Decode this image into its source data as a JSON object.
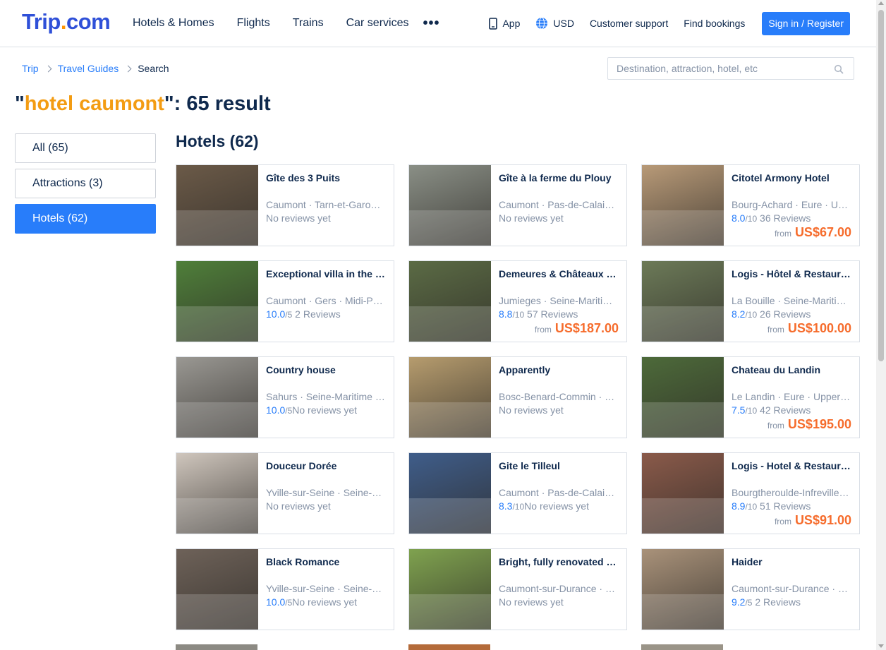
{
  "header": {
    "logo_main": "Trip",
    "logo_dot": ".",
    "logo_suffix": "com",
    "nav": [
      "Hotels & Homes",
      "Flights",
      "Trains",
      "Car services"
    ],
    "more": "•••",
    "app": "App",
    "currency": "USD",
    "support": "Customer support",
    "bookings": "Find bookings",
    "signin": "Sign in / Register"
  },
  "breadcrumb": {
    "items": [
      "Trip",
      "Travel Guides"
    ],
    "current": "Search"
  },
  "search": {
    "placeholder": "Destination, attraction, hotel, etc"
  },
  "headline": {
    "quote_open": "\"",
    "keyword": "hotel caumont",
    "rest": "\": 65 result"
  },
  "filters": [
    "All (65)",
    "Attractions (3)",
    "Hotels (62)"
  ],
  "section": {
    "title": "Hotels (62)"
  },
  "hotels": [
    {
      "name": "Gîte des 3 Puits",
      "location": "Caumont · Tarn-et-Garonne · Occitanie",
      "score": "",
      "scale": "",
      "reviews": "No reviews yet",
      "from": "",
      "price": "",
      "thumb": "#6b5a48"
    },
    {
      "name": "Gîte à la ferme du Plouy",
      "location": "Caumont · Pas-de-Calais · Hauts-de-France",
      "score": "",
      "scale": "",
      "reviews": "No reviews yet",
      "from": "",
      "price": "",
      "thumb": "#8a8f86"
    },
    {
      "name": "Citotel Armony Hotel",
      "location": "Bourg-Achard · Eure · Upper Normandy",
      "score": "8.0",
      "scale": "/10",
      "reviews": " 36 Reviews",
      "from": "from",
      "price": "US$67.00",
      "thumb": "#b89a78"
    },
    {
      "name": "Exceptional villa in the countryside",
      "location": "Caumont · Gers · Midi-Pyrénées",
      "score": "10.0",
      "scale": "/5",
      "reviews": " 2 Reviews",
      "from": "",
      "price": "",
      "thumb": "#4f7f3a"
    },
    {
      "name": "Demeures & Châteaux Hotel",
      "location": "Jumieges · Seine-Maritime · Normandy",
      "score": "8.8",
      "scale": "/10",
      "reviews": " 57 Reviews",
      "from": "from",
      "price": "US$187.00",
      "thumb": "#5b6b45"
    },
    {
      "name": "Logis - Hôtel & Restaurant",
      "location": "La Bouille · Seine-Maritime · Normandy",
      "score": "8.2",
      "scale": "/10",
      "reviews": " 26 Reviews",
      "from": "from",
      "price": "US$100.00",
      "thumb": "#6c7a58"
    },
    {
      "name": "Country house",
      "location": "Sahurs · Seine-Maritime · Normandy",
      "score": "10.0",
      "scale": "/5",
      "reviews": "No reviews yet",
      "from": "",
      "price": "",
      "thumb": "#9a9893"
    },
    {
      "name": "Apparently",
      "location": "Bosc-Benard-Commin · Eure · Normandy",
      "score": "",
      "scale": "",
      "reviews": "No reviews yet",
      "from": "",
      "price": "",
      "thumb": "#b69c6e"
    },
    {
      "name": "Chateau du Landin",
      "location": "Le Landin · Eure · Upper Normandy",
      "score": "7.5",
      "scale": "/10",
      "reviews": " 42 Reviews",
      "from": "from",
      "price": "US$195.00",
      "thumb": "#4d6a3a"
    },
    {
      "name": "Douceur Dorée",
      "location": "Yville-sur-Seine · Seine-Maritime",
      "score": "",
      "scale": "",
      "reviews": "No reviews yet",
      "from": "",
      "price": "",
      "thumb": "#cfc6bd"
    },
    {
      "name": "Gite le Tilleul",
      "location": "Caumont · Pas-de-Calais · Hauts-de-France",
      "score": "8.3",
      "scale": "/10",
      "reviews": "No reviews yet",
      "from": "",
      "price": "",
      "thumb": "#3f5d8a"
    },
    {
      "name": "Logis - Hotel & Restaurant",
      "location": "Bourgtheroulde-Infreville · Eure",
      "score": "8.9",
      "scale": "/10",
      "reviews": " 51 Reviews",
      "from": "from",
      "price": "US$91.00",
      "thumb": "#8a5a4a"
    },
    {
      "name": "Black Romance",
      "location": "Yville-sur-Seine · Seine-Maritime",
      "score": "10.0",
      "scale": "/5",
      "reviews": "No reviews yet",
      "from": "",
      "price": "",
      "thumb": "#6e6259"
    },
    {
      "name": "Bright, fully renovated house",
      "location": "Caumont-sur-Durance · Vaucluse",
      "score": "",
      "scale": "",
      "reviews": "No reviews yet",
      "from": "",
      "price": "",
      "thumb": "#7fa24f"
    },
    {
      "name": "Haider",
      "location": "Caumont-sur-Durance · Vaucluse",
      "score": "9.2",
      "scale": "/5",
      "reviews": " 2 Reviews",
      "from": "",
      "price": "",
      "thumb": "#a9927a"
    }
  ],
  "colors": {
    "brand": "#287dfa",
    "keyword": "#f39c12",
    "price": "#f66c2c",
    "text": "#0f294d",
    "muted": "#8592a6"
  }
}
